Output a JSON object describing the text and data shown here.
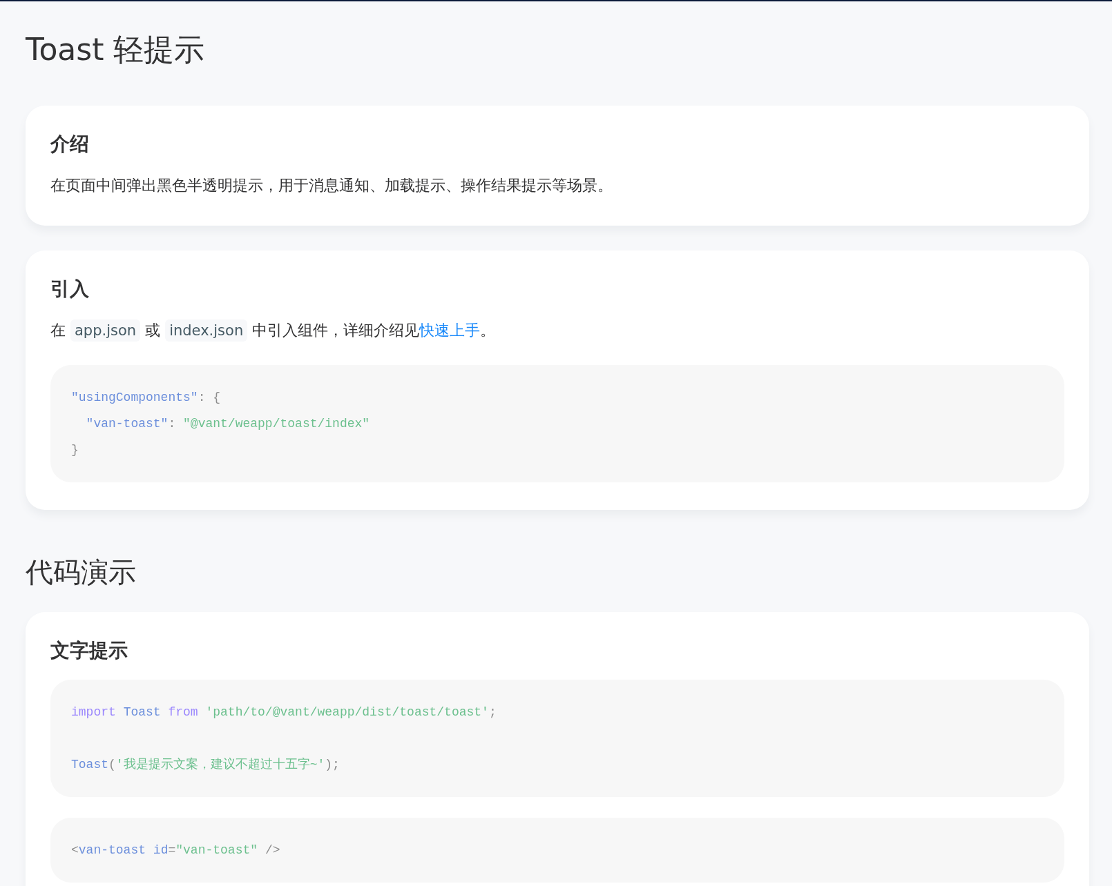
{
  "page": {
    "title": "Toast 轻提示"
  },
  "cards": [
    {
      "heading": "介绍",
      "paragraph": [
        {
          "kind": "text",
          "text": "在页面中间弹出黑色半透明提示，用于消息通知、加载提示、操作结果提示等场景。"
        }
      ]
    },
    {
      "heading": "引入",
      "paragraph": [
        {
          "kind": "text",
          "text": "在 "
        },
        {
          "kind": "code",
          "text": "app.json"
        },
        {
          "kind": "text",
          "text": " 或 "
        },
        {
          "kind": "code",
          "text": "index.json"
        },
        {
          "kind": "text",
          "text": " 中引入组件，详细介绍见"
        },
        {
          "kind": "link",
          "text": "快速上手"
        },
        {
          "kind": "text",
          "text": "。"
        }
      ],
      "code_blocks": [
        {
          "lines": [
            {
              "blank_before": false,
              "tokens": [
                {
                  "kind": "name",
                  "text": "\"usingComponents\""
                },
                {
                  "kind": "punct",
                  "text": ": {"
                }
              ]
            },
            {
              "blank_before": false,
              "tokens": [
                {
                  "kind": "name",
                  "text": "  \"van-toast\""
                },
                {
                  "kind": "punct",
                  "text": ": "
                },
                {
                  "kind": "string",
                  "text": "\"@vant/weapp/toast/index\""
                }
              ]
            },
            {
              "blank_before": false,
              "tokens": [
                {
                  "kind": "punct",
                  "text": "}"
                }
              ]
            }
          ]
        }
      ]
    }
  ],
  "section": {
    "title": "代码演示"
  },
  "demo_cards": [
    {
      "heading": "文字提示",
      "code_blocks": [
        {
          "lines": [
            {
              "blank_before": false,
              "tokens": [
                {
                  "kind": "keyword",
                  "text": "import "
                },
                {
                  "kind": "name",
                  "text": "Toast "
                },
                {
                  "kind": "keyword",
                  "text": "from "
                },
                {
                  "kind": "string",
                  "text": "'path/to/@vant/weapp/dist/toast/toast'"
                },
                {
                  "kind": "punct",
                  "text": ";"
                }
              ]
            },
            {
              "blank_before": true,
              "tokens": [
                {
                  "kind": "name",
                  "text": "Toast"
                },
                {
                  "kind": "punct",
                  "text": "("
                },
                {
                  "kind": "string",
                  "text": "'我是提示文案，建议不超过十五字~'"
                },
                {
                  "kind": "punct",
                  "text": ");"
                }
              ]
            }
          ]
        },
        {
          "lines": [
            {
              "blank_before": false,
              "tokens": [
                {
                  "kind": "punct",
                  "text": "<"
                },
                {
                  "kind": "name",
                  "text": "van-toast id"
                },
                {
                  "kind": "punct",
                  "text": "="
                },
                {
                  "kind": "string",
                  "text": "\"van-toast\""
                },
                {
                  "kind": "punct",
                  "text": " />"
                }
              ]
            }
          ]
        }
      ]
    }
  ]
}
